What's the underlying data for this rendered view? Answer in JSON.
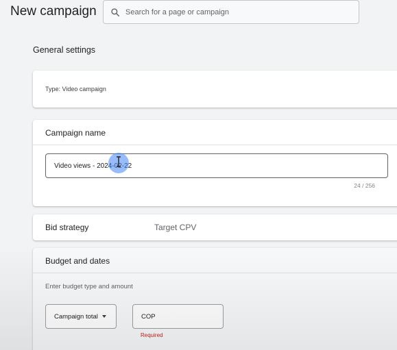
{
  "header": {
    "title": "New campaign",
    "search": {
      "placeholder": "Search for a page or campaign",
      "value": ""
    }
  },
  "general_settings": {
    "heading": "General settings",
    "type_text": "Type: Video campaign"
  },
  "campaign_name": {
    "title": "Campaign name",
    "value": "Video views - 2024-02-22",
    "char_count": "24 / 256"
  },
  "bid_strategy": {
    "label": "Bid strategy",
    "value": "Target CPV"
  },
  "budget": {
    "title": "Budget and dates",
    "hint": "Enter budget type and amount",
    "type_select": "Campaign total",
    "currency": "COP",
    "amount": "",
    "validation": "Required"
  },
  "colors": {
    "background": "#f1f3f4",
    "card": "#ffffff",
    "error": "#c5221f",
    "cursor_highlight": "#4285f4"
  }
}
